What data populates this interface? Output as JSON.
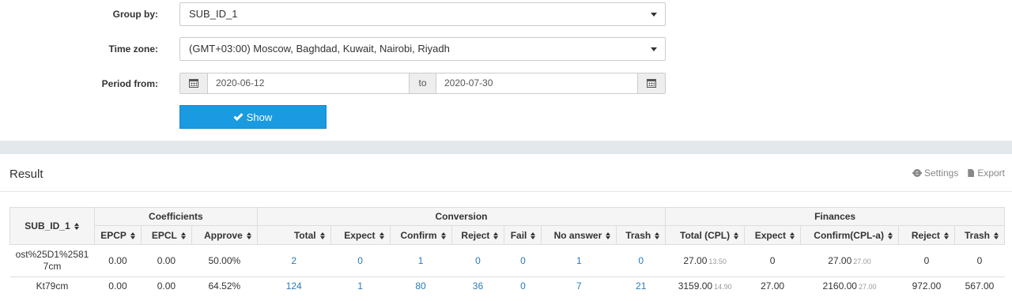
{
  "form": {
    "group_by": {
      "label": "Group by:",
      "value": "SUB_ID_1"
    },
    "time_zone": {
      "label": "Time zone:",
      "value": "(GMT+03:00) Moscow, Baghdad, Kuwait, Nairobi, Riyadh"
    },
    "period": {
      "label": "Period from:",
      "from": "2020-06-12",
      "to_label": "to",
      "to": "2020-07-30"
    },
    "show_button": "Show"
  },
  "result": {
    "title": "Result",
    "settings_label": "Settings",
    "export_label": "Export"
  },
  "table": {
    "groups": {
      "sub_id": "SUB_ID_1",
      "coefficients": "Coefficients",
      "conversion": "Conversion",
      "finances": "Finances"
    },
    "columns": [
      "EPCP",
      "EPCL",
      "Approve",
      "Total",
      "Expect",
      "Confirm",
      "Reject",
      "Fail",
      "No answer",
      "Trash",
      "Total (CPL)",
      "Expect",
      "Confirm(CPL-a)",
      "Reject",
      "Trash"
    ],
    "rows": [
      {
        "sub_id": "ost%25D1%2581\n7cm",
        "epcp": "0.00",
        "epcl": "0.00",
        "approve": "50.00%",
        "total": "2",
        "expect": "0",
        "confirm": "1",
        "reject": "0",
        "fail": "0",
        "no_answer": "1",
        "trash": "0",
        "fin_total": "27.00",
        "fin_total_sub": "13.50",
        "fin_expect": "0",
        "fin_confirm": "27.00",
        "fin_confirm_sub": "27.00",
        "fin_reject": "0",
        "fin_trash": "0"
      },
      {
        "sub_id": "Kt79cm",
        "epcp": "0.00",
        "epcl": "0.00",
        "approve": "64.52%",
        "total": "124",
        "expect": "1",
        "confirm": "80",
        "reject": "36",
        "fail": "0",
        "no_answer": "7",
        "trash": "21",
        "fin_total": "3159.00",
        "fin_total_sub": "14.90",
        "fin_expect": "27.00",
        "fin_confirm": "2160.00",
        "fin_confirm_sub": "27.00",
        "fin_reject": "972.00",
        "fin_trash": "567.00"
      }
    ]
  },
  "colors": {
    "primary_button": "#1a9ae0",
    "link": "#2a7ab9",
    "band": "#e3e8ec"
  }
}
